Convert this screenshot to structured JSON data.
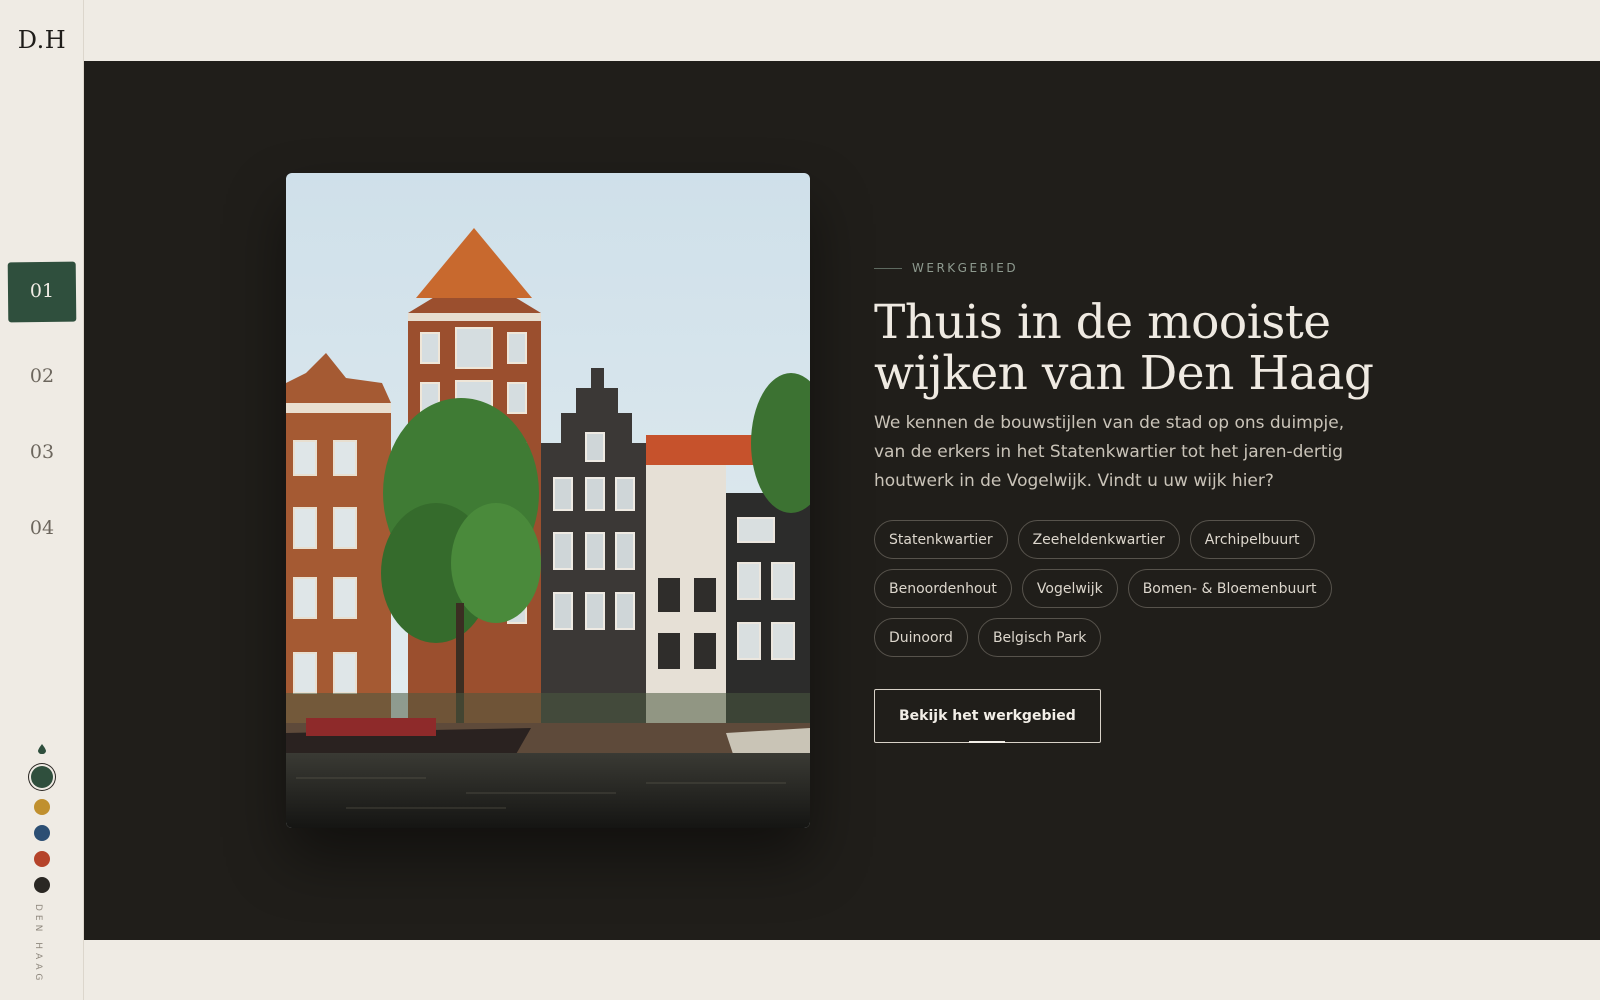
{
  "brand": {
    "logo": "D.H"
  },
  "steps": [
    {
      "label": "01",
      "active": true
    },
    {
      "label": "02",
      "active": false
    },
    {
      "label": "03",
      "active": false
    },
    {
      "label": "04",
      "active": false
    }
  ],
  "swatches": {
    "icon": "drop-icon",
    "colors": [
      "#2f4f3d",
      "#c0902f",
      "#2c4f74",
      "#b5432a",
      "#2a2723"
    ],
    "selected_index": 0
  },
  "sidebar_label": "DEN HAAG",
  "section": {
    "eyebrow": "WERKGEBIED",
    "headline": "Thuis in de mooiste wijken van Den Haag",
    "lead": "We kennen de bouwstijlen van de stad op ons duimpje, van de erkers in het Statenkwartier tot het jaren-dertig houtwerk in de Vogelwijk. Vindt u uw wijk hier?",
    "chips": [
      "Statenkwartier",
      "Zeeheldenkwartier",
      "Archipelbuurt",
      "Benoordenhout",
      "Vogelwijk",
      "Bomen- & Bloemenbuurt",
      "Duinoord",
      "Belgisch Park"
    ],
    "cta": "Bekijk het werkgebied"
  },
  "colors": {
    "page_bg": "#efebe4",
    "panel_bg": "#201e1a",
    "accent_green": "#2f4f3d"
  }
}
